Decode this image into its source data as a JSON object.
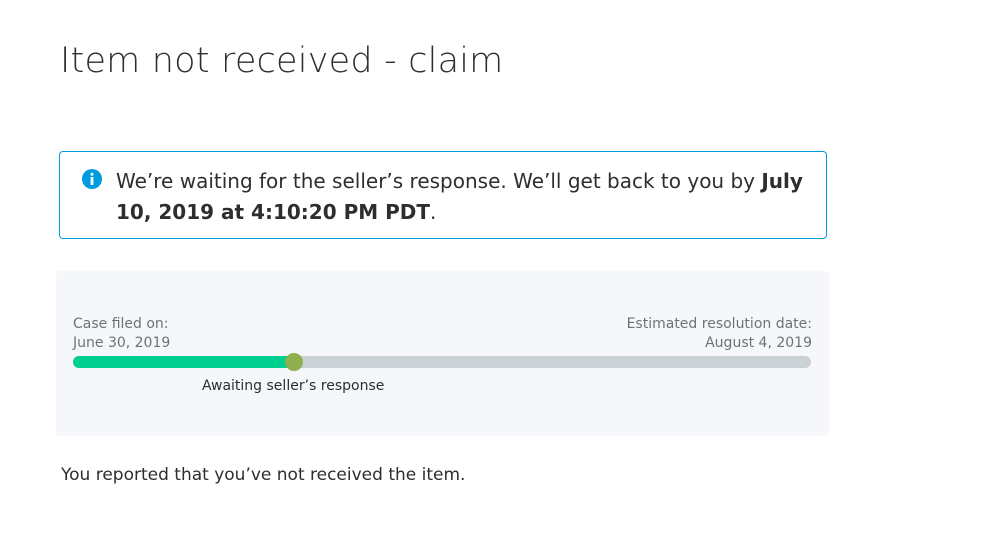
{
  "page": {
    "title": "Item not received - claim"
  },
  "alert": {
    "icon": "info-icon",
    "text_prefix": "We’re waiting for the seller’s response. We’ll get back to you by ",
    "deadline": "July 10, 2019 at 4:10:20 PM PDT",
    "text_suffix": ".",
    "accent_color": "#009cde"
  },
  "tracker": {
    "filed_label": "Case filed on:",
    "filed_date": "June 30, 2019",
    "estimated_label": "Estimated resolution date:",
    "estimated_date": "August 4, 2019",
    "progress_fraction": 0.3,
    "stage_label": "Awaiting seller’s response",
    "fill_color": "#00cf92",
    "marker_color": "#8eb04f",
    "track_color": "#cbd2d6"
  },
  "report": {
    "text": "You reported that you’ve not received the item."
  }
}
